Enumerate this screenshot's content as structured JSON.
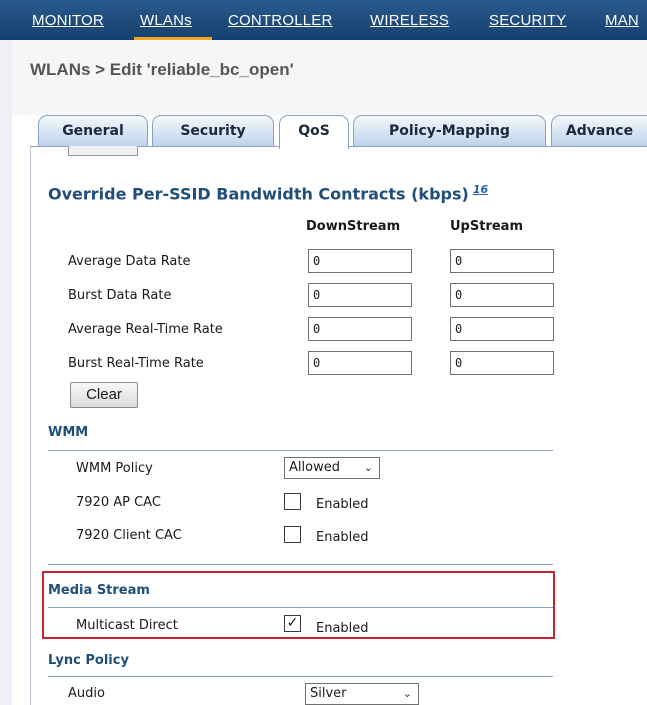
{
  "nav": {
    "items": [
      {
        "label": "MONITOR"
      },
      {
        "label": "WLANs"
      },
      {
        "label": "CONTROLLER"
      },
      {
        "label": "WIRELESS"
      },
      {
        "label": "SECURITY"
      },
      {
        "label": "MAN"
      }
    ],
    "active": "WLANs",
    "accent_color": "#f5a623"
  },
  "breadcrumb": "WLANs > Edit  'reliable_bc_open'",
  "tabs": [
    {
      "label": "General"
    },
    {
      "label": "Security"
    },
    {
      "label": "QoS"
    },
    {
      "label": "Policy-Mapping"
    },
    {
      "label": "Advance"
    }
  ],
  "active_tab": "QoS",
  "bandwidth": {
    "title": "Override Per-SSID Bandwidth Contracts (kbps)",
    "footnote": "16",
    "col_downstream": "DownStream",
    "col_upstream": "UpStream",
    "rows": [
      {
        "label": "Average Data Rate",
        "down": "0",
        "up": "0"
      },
      {
        "label": "Burst Data Rate",
        "down": "0",
        "up": "0"
      },
      {
        "label": "Average Real-Time Rate",
        "down": "0",
        "up": "0"
      },
      {
        "label": "Burst Real-Time Rate",
        "down": "0",
        "up": "0"
      }
    ],
    "clear_label": "Clear"
  },
  "wmm": {
    "title": "WMM",
    "policy_label": "WMM Policy",
    "policy_value": "Allowed",
    "ap_cac_label": "7920 AP CAC",
    "ap_cac_option": "Enabled",
    "ap_cac_checked": false,
    "client_cac_label": "7920 Client CAC",
    "client_cac_option": "Enabled",
    "client_cac_checked": false
  },
  "media_stream": {
    "title": "Media Stream",
    "multicast_label": "Multicast Direct",
    "multicast_option": "Enabled",
    "multicast_checked": true,
    "highlight_color": "#c8242c"
  },
  "lync": {
    "title": "Lync Policy",
    "audio_label": "Audio",
    "audio_value": "Silver"
  }
}
